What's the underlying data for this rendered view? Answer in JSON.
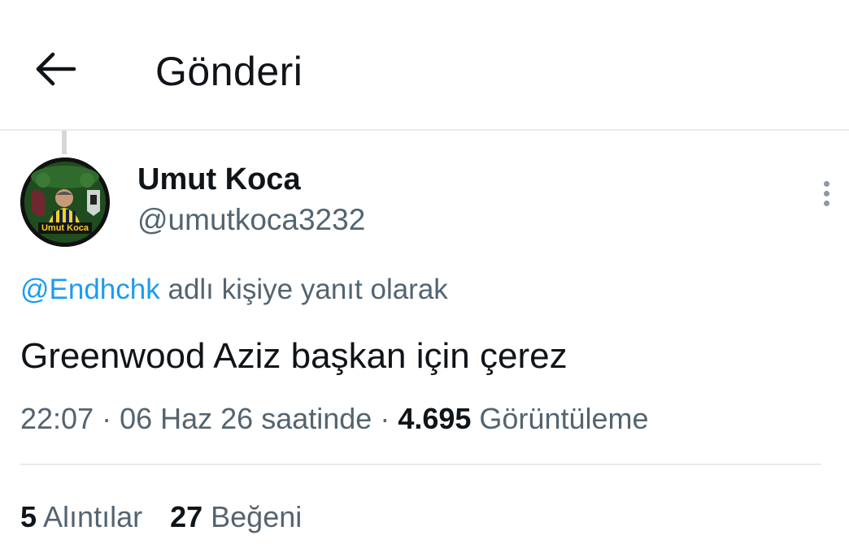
{
  "header": {
    "title": "Gönderi",
    "back_icon": "arrow-left-icon"
  },
  "tweet": {
    "author": {
      "name": "Umut Koca",
      "handle": "@umutkoca3232",
      "avatar_caption": "Umut Koca"
    },
    "reply": {
      "mention": "@Endhchk",
      "suffix": " adlı kişiye yanıt olarak"
    },
    "text": "Greenwood Aziz başkan için çerez",
    "meta": {
      "time": "22:07",
      "separator": " · ",
      "date": "06 Haz 26 saatinde",
      "views_count": "4.695",
      "views_label": " Görüntüleme"
    },
    "stats": [
      {
        "count": "5",
        "label": " Alıntılar"
      },
      {
        "count": "27",
        "label": " Beğeni"
      }
    ]
  },
  "colors": {
    "text": "#0f1419",
    "secondary": "#536471",
    "link": "#1d9bf0",
    "divider": "#e8ebed"
  }
}
